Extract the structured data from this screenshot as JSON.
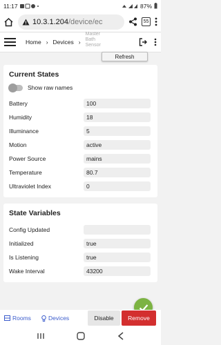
{
  "status_bar": {
    "time": "11:17",
    "battery": "87%"
  },
  "browser": {
    "url_host": "10.3.1.204",
    "url_path": "/device/ec",
    "tab_count": "55"
  },
  "header": {
    "breadcrumb_home": "Home",
    "breadcrumb_devices": "Devices",
    "breadcrumb_device": "Master Bath Sensor"
  },
  "refresh_label": "Refresh",
  "current_states": {
    "title": "Current States",
    "toggle_label": "Show raw names",
    "rows": [
      {
        "label": "Battery",
        "value": "100"
      },
      {
        "label": "Humidity",
        "value": "18"
      },
      {
        "label": "Illuminance",
        "value": "5"
      },
      {
        "label": "Motion",
        "value": "active"
      },
      {
        "label": "Power Source",
        "value": "mains"
      },
      {
        "label": "Temperature",
        "value": "80.7"
      },
      {
        "label": "Ultraviolet Index",
        "value": "0"
      }
    ]
  },
  "state_variables": {
    "title": "State Variables",
    "rows": [
      {
        "label": "Config Updated",
        "value": ""
      },
      {
        "label": "Initialized",
        "value": "true"
      },
      {
        "label": "Is Listening",
        "value": "true"
      },
      {
        "label": "Wake Interval",
        "value": "43200"
      }
    ]
  },
  "bottom_bar": {
    "rooms_label": "Rooms",
    "devices_label": "Devices",
    "disable_label": "Disable",
    "remove_label": "Remove"
  },
  "colors": {
    "accent_green": "#7cb342",
    "remove_red": "#d32f2f",
    "link_blue": "#3b5ccc"
  }
}
